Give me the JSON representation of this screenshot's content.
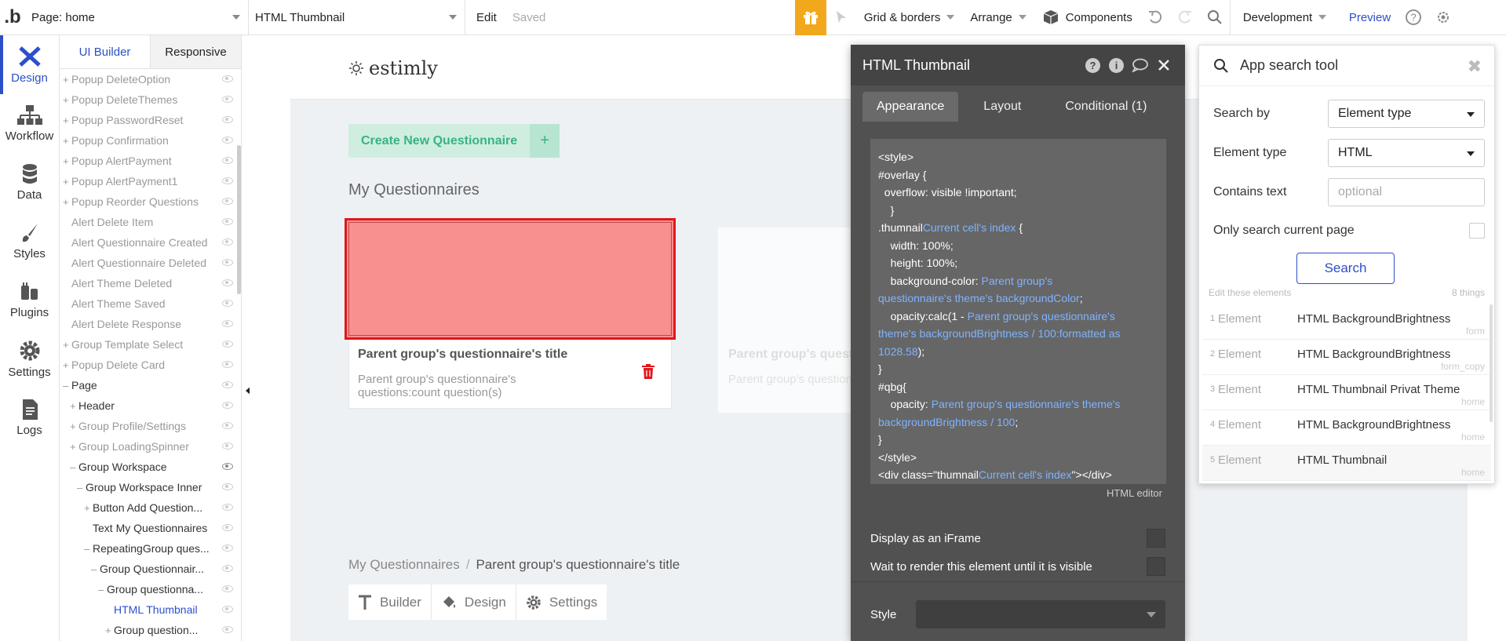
{
  "topbar": {
    "logo": ".b",
    "page_select": "Page: home",
    "element_select": "HTML Thumbnail",
    "edit": "Edit",
    "saved": "Saved",
    "grid_borders": "Grid & borders",
    "arrange": "Arrange",
    "components": "Components",
    "development": "Development",
    "preview": "Preview",
    "gift_color": "#f2a81d"
  },
  "rail": {
    "items": [
      {
        "label": "Design",
        "icon": "design-icon"
      },
      {
        "label": "Workflow",
        "icon": "workflow-icon"
      },
      {
        "label": "Data",
        "icon": "database-icon"
      },
      {
        "label": "Styles",
        "icon": "brush-icon"
      },
      {
        "label": "Plugins",
        "icon": "plug-icon"
      },
      {
        "label": "Settings",
        "icon": "gear-icon"
      },
      {
        "label": "Logs",
        "icon": "document-icon"
      }
    ]
  },
  "tree": {
    "tabs": [
      "UI Builder",
      "Responsive"
    ],
    "rows": [
      {
        "label": "Popup DeleteOption",
        "indent": 0,
        "pm": "+",
        "style": "muted"
      },
      {
        "label": "Popup DeleteThemes",
        "indent": 0,
        "pm": "+",
        "style": "muted"
      },
      {
        "label": "Popup PasswordReset",
        "indent": 0,
        "pm": "+",
        "style": "muted"
      },
      {
        "label": "Popup Confirmation",
        "indent": 0,
        "pm": "+",
        "style": "muted"
      },
      {
        "label": "Popup AlertPayment",
        "indent": 0,
        "pm": "+",
        "style": "muted"
      },
      {
        "label": "Popup AlertPayment1",
        "indent": 0,
        "pm": "+",
        "style": "muted"
      },
      {
        "label": "Popup Reorder Questions",
        "indent": 0,
        "pm": "+",
        "style": "muted"
      },
      {
        "label": "Alert Delete Item",
        "indent": 0,
        "pm": " ",
        "style": "muted"
      },
      {
        "label": "Alert Questionnaire Created",
        "indent": 0,
        "pm": " ",
        "style": "muted"
      },
      {
        "label": "Alert Questionnaire Deleted",
        "indent": 0,
        "pm": " ",
        "style": "muted"
      },
      {
        "label": "Alert Theme Deleted",
        "indent": 0,
        "pm": " ",
        "style": "muted"
      },
      {
        "label": "Alert Theme Saved",
        "indent": 0,
        "pm": " ",
        "style": "muted"
      },
      {
        "label": "Alert Delete Response",
        "indent": 0,
        "pm": " ",
        "style": "muted"
      },
      {
        "label": "Group Template Select",
        "indent": 0,
        "pm": "+",
        "style": "muted"
      },
      {
        "label": "Popup Delete Card",
        "indent": 0,
        "pm": "+",
        "style": "muted"
      },
      {
        "label": "Page",
        "indent": 0,
        "pm": "–",
        "style": "dark"
      },
      {
        "label": "Header",
        "indent": 1,
        "pm": "+",
        "style": "dark"
      },
      {
        "label": "Group Profile/Settings",
        "indent": 1,
        "pm": "+",
        "style": "muted"
      },
      {
        "label": "Group LoadingSpinner",
        "indent": 1,
        "pm": "+",
        "style": "muted"
      },
      {
        "label": "Group Workspace",
        "indent": 1,
        "pm": "–",
        "style": "dark",
        "eye": "on"
      },
      {
        "label": "Group Workspace Inner",
        "indent": 2,
        "pm": "–",
        "style": "dark"
      },
      {
        "label": "Button Add Question...",
        "indent": 3,
        "pm": "+",
        "style": "dark"
      },
      {
        "label": "Text My Questionnaires",
        "indent": 3,
        "pm": " ",
        "style": "dark"
      },
      {
        "label": "RepeatingGroup ques...",
        "indent": 3,
        "pm": "–",
        "style": "dark"
      },
      {
        "label": "Group Questionnair...",
        "indent": 4,
        "pm": "–",
        "style": "dark"
      },
      {
        "label": "Group questionna...",
        "indent": 5,
        "pm": "–",
        "style": "dark"
      },
      {
        "label": "HTML Thumbnail",
        "indent": 6,
        "pm": " ",
        "style": "sel"
      },
      {
        "label": "Group question...",
        "indent": 6,
        "pm": "+",
        "style": "dark"
      }
    ]
  },
  "canvas": {
    "logo_text": "estimly",
    "create_button": "Create New Questionnaire",
    "create_plus": "+",
    "my_questionnaires": "My Questionnaires",
    "card_title": "Parent group's questionnaire's title",
    "card_sub": "Parent group's questionnaire's questions:count  question(s)",
    "card2_title": "Parent group's quest",
    "card2_sub": "Parent group's questionnaire's questions:count  que",
    "breadcrumb_root": "My Questionnaires",
    "breadcrumb_sep": "/",
    "breadcrumb_current": "Parent group's questionnaire's title",
    "subtabs": [
      "Builder",
      "Design",
      "Settings"
    ],
    "accent_green": "#37b386",
    "thumbnail_color": "#f89090"
  },
  "prop_editor": {
    "title": "HTML Thumbnail",
    "tabs": [
      "Appearance",
      "Layout",
      "Conditional (1)"
    ],
    "code_lines": [
      [
        {
          "t": "<style>"
        }
      ],
      [
        {
          "t": "#overlay {"
        }
      ],
      [
        {
          "t": "  overflow: visible !important;"
        }
      ],
      [
        {
          "t": "    }"
        }
      ],
      [
        {
          "t": ".thumnail"
        },
        {
          "t": "Current cell's index",
          "d": true
        },
        {
          "t": " {"
        }
      ],
      [
        {
          "t": "    width: 100%;"
        }
      ],
      [
        {
          "t": "    height: 100%;"
        }
      ],
      [
        {
          "t": "    background-color: "
        },
        {
          "t": "Parent group's",
          "d": true
        }
      ],
      [
        {
          "t": "questionnaire's theme's backgroundColor",
          "d": true
        },
        {
          "t": ";"
        }
      ],
      [
        {
          "t": "    opacity:calc(1 - "
        },
        {
          "t": "Parent group's questionnaire's",
          "d": true
        }
      ],
      [
        {
          "t": "theme's backgroundBrightness / 100:formatted as",
          "d": true
        }
      ],
      [
        {
          "t": "1028.58",
          "d": true
        },
        {
          "t": ");"
        }
      ],
      [
        {
          "t": "}"
        }
      ],
      [
        {
          "t": "#qbg{"
        }
      ],
      [
        {
          "t": "    opacity: "
        },
        {
          "t": "Parent group's questionnaire's theme's",
          "d": true
        }
      ],
      [
        {
          "t": "backgroundBrightness / 100",
          "d": true
        },
        {
          "t": ";"
        }
      ],
      [
        {
          "t": "}"
        }
      ],
      [
        {
          "t": "</style>"
        }
      ],
      [
        {
          "t": "<div class=\"thumnail"
        },
        {
          "t": "Current cell's index",
          "d": true
        },
        {
          "t": "\"></div>"
        }
      ]
    ],
    "html_editor_label": "HTML editor",
    "display_iframe": "Display as an iFrame",
    "wait_render": "Wait to render this element until it is visible",
    "style_label": "Style"
  },
  "search_tool": {
    "title": "App search tool",
    "search_by_label": "Search by",
    "search_by_value": "Element type",
    "element_type_label": "Element type",
    "element_type_value": "HTML",
    "contains_label": "Contains text",
    "contains_placeholder": "optional",
    "only_current_label": "Only search current page",
    "search_button": "Search",
    "edit_these": "Edit these elements",
    "count": "8 things",
    "results": [
      {
        "n": "1",
        "type": "Element",
        "name": "HTML BackgroundBrightness",
        "page": "form"
      },
      {
        "n": "2",
        "type": "Element",
        "name": "HTML BackgroundBrightness",
        "page": "form_copy"
      },
      {
        "n": "3",
        "type": "Element",
        "name": "HTML Thumbnail Privat Theme",
        "page": "home"
      },
      {
        "n": "4",
        "type": "Element",
        "name": "HTML BackgroundBrightness",
        "page": "home"
      },
      {
        "n": "5",
        "type": "Element",
        "name": "HTML Thumbnail",
        "page": "home"
      }
    ]
  }
}
